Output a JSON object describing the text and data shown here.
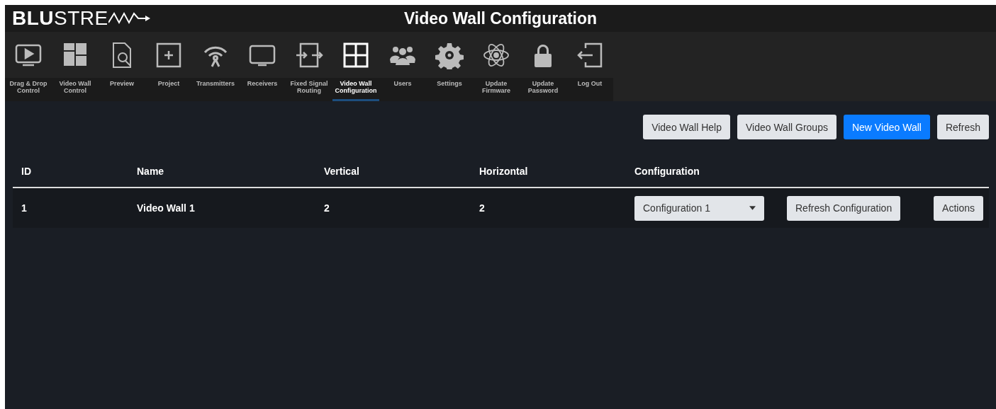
{
  "header": {
    "logo": "**BLU**STRE",
    "title": "Video Wall Configuration"
  },
  "nav": [
    {
      "label": "Drag & Drop Control",
      "selected": false
    },
    {
      "label": "Video Wall Control",
      "selected": false
    },
    {
      "label": "Preview",
      "selected": false
    },
    {
      "label": "Project",
      "selected": false
    },
    {
      "label": "Transmitters",
      "selected": false
    },
    {
      "label": "Receivers",
      "selected": false
    },
    {
      "label": "Fixed Signal Routing",
      "selected": false
    },
    {
      "label": "Video Wall Configuration",
      "selected": true
    },
    {
      "label": "Users",
      "selected": false
    },
    {
      "label": "Settings",
      "selected": false
    },
    {
      "label": "Update Firmware",
      "selected": false
    },
    {
      "label": "Update Password",
      "selected": false
    },
    {
      "label": "Log Out",
      "selected": false
    }
  ],
  "toolbar": [
    {
      "label": "Video Wall Help",
      "kind": "secondary"
    },
    {
      "label": "Video Wall Groups",
      "kind": "secondary"
    },
    {
      "label": "New Video Wall",
      "kind": "primary"
    },
    {
      "label": "Refresh",
      "kind": "secondary"
    }
  ],
  "table": {
    "columns": [
      "ID",
      "Name",
      "Vertical",
      "Horizontal",
      "Configuration"
    ],
    "rows": [
      {
        "id": "1",
        "name": "Video Wall 1",
        "vertical": "2",
        "horizontal": "2",
        "configuration": "Configuration 1",
        "refresh_button": "Refresh Configuration",
        "actions_button": "Actions"
      }
    ]
  }
}
